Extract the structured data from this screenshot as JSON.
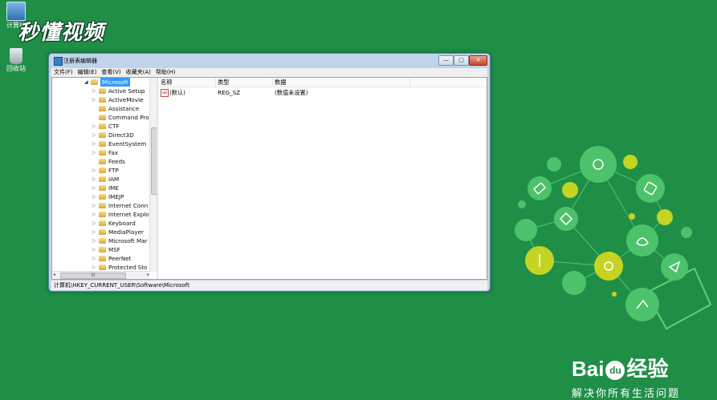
{
  "desktop": {
    "icons": [
      {
        "label": "计算机"
      },
      {
        "label": "回收站"
      }
    ],
    "brand": "秒懂视频"
  },
  "window": {
    "title": "注册表编辑器",
    "buttons": {
      "minimize": "—",
      "maximize": "□",
      "close": "✕"
    },
    "menu": [
      "文件(F)",
      "编辑(E)",
      "查看(V)",
      "收藏夹(A)",
      "帮助(H)"
    ],
    "tree": {
      "root": "Microsoft",
      "items": [
        {
          "label": "Active Setup",
          "arrow": "▷"
        },
        {
          "label": "ActiveMovie",
          "arrow": "▷"
        },
        {
          "label": "Assistance",
          "arrow": ""
        },
        {
          "label": "Command Pro",
          "arrow": ""
        },
        {
          "label": "CTF",
          "arrow": "▷"
        },
        {
          "label": "Direct3D",
          "arrow": "▷"
        },
        {
          "label": "EventSystem",
          "arrow": "▷"
        },
        {
          "label": "Fax",
          "arrow": "▷"
        },
        {
          "label": "Feeds",
          "arrow": ""
        },
        {
          "label": "FTP",
          "arrow": "▷"
        },
        {
          "label": "IAM",
          "arrow": "▷"
        },
        {
          "label": "IME",
          "arrow": "▷"
        },
        {
          "label": "IMEJP",
          "arrow": "▷"
        },
        {
          "label": "Internet Conn",
          "arrow": "▷"
        },
        {
          "label": "Internet Explo",
          "arrow": "▷"
        },
        {
          "label": "Keyboard",
          "arrow": "▷"
        },
        {
          "label": "MediaPlayer",
          "arrow": "▷"
        },
        {
          "label": "Microsoft Mar",
          "arrow": "▷"
        },
        {
          "label": "MSF",
          "arrow": "▷"
        },
        {
          "label": "PeerNet",
          "arrow": "▷"
        },
        {
          "label": "Protected Sto",
          "arrow": "▷"
        }
      ]
    },
    "list": {
      "headers": {
        "name": "名称",
        "type": "类型",
        "data": "数据"
      },
      "rows": [
        {
          "name": "(默认)",
          "type": "REG_SZ",
          "data": "(数值未设置)",
          "icon": "ab"
        }
      ]
    },
    "status_path": "计算机\\HKEY_CURRENT_USER\\Software\\Microsoft",
    "scroll_glyph": "III"
  },
  "watermark": {
    "logo_left": "Bai",
    "logo_paw": "du",
    "logo_right": "经验",
    "slogan": "解决你所有生活问题"
  },
  "colors": {
    "background": "#1f8f47",
    "selection": "#3399ff",
    "bulb_node": "#4cc26a",
    "bulb_accent": "#c5d423"
  }
}
